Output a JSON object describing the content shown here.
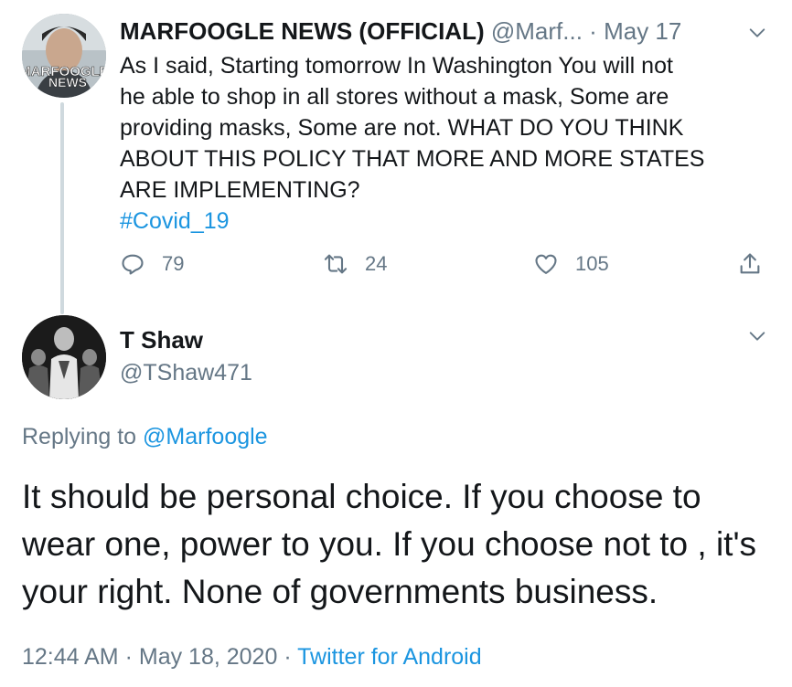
{
  "parent_tweet": {
    "avatar_overlay_text": "MARFOOGLE NEWS",
    "author_name": "MARFOOGLE NEWS (OFFICIAL)",
    "author_handle": "@Marf...",
    "separator": "·",
    "date": "May 17",
    "body_lines": [
      "As I said, Starting tomorrow In Washington You will not",
      "he able to shop in all stores without a mask, Some are",
      "providing masks, Some are not. WHAT DO YOU THINK",
      "ABOUT THIS POLICY THAT MORE AND MORE STATES",
      "ARE IMPLEMENTING?"
    ],
    "hashtag": "#Covid_19",
    "reply_count": "79",
    "retweet_count": "24",
    "like_count": "105"
  },
  "reply_tweet": {
    "author_name": "T Shaw",
    "author_handle": "@TShaw471",
    "replying_prefix": "Replying to",
    "replying_to": "@Marfoogle",
    "body": "It should be personal choice. If you choose to wear one, power to you. If you choose not to , it's your right. None of governments business.",
    "time": "12:44 AM",
    "date": "May 18, 2020",
    "source": "Twitter for Android",
    "separator": "·"
  },
  "icons": {
    "reply": "reply-icon",
    "retweet": "retweet-icon",
    "like": "heart-icon",
    "share": "share-icon",
    "more": "chevron-down-icon"
  },
  "colors": {
    "text": "#14171a",
    "muted": "#657786",
    "link": "#1b95e0",
    "thread_line": "#cfd9de"
  }
}
